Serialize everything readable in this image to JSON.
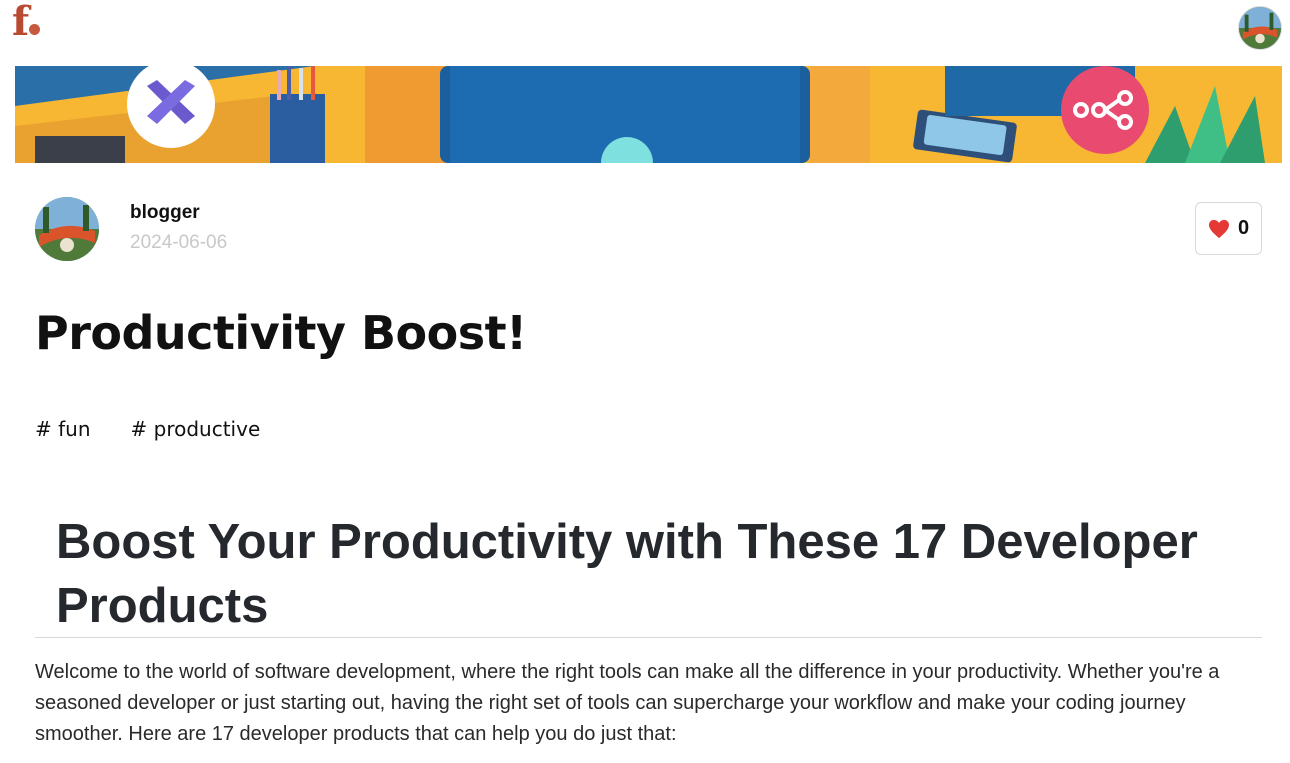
{
  "header": {
    "logo_text": "f",
    "logo_icon": "brand-logo-icon",
    "user_avatar_icon": "user-avatar"
  },
  "banner": {
    "image_icon": "desk-illustration-banner",
    "left_badge_icon": "tools-icon",
    "right_badge_icon": "workflow-nodes-icon"
  },
  "author": {
    "name": "blogger",
    "date": "2024-06-06",
    "avatar_icon": "author-avatar"
  },
  "like": {
    "icon": "heart-icon",
    "count": "0",
    "color": "#e53935"
  },
  "post": {
    "title": "Productivity Boost!",
    "tags": [
      "# fun",
      "# productive"
    ]
  },
  "article": {
    "heading": "Boost Your Productivity with These 17 Developer Products",
    "intro": "Welcome to the world of software development, where the right tools can make all the difference in your productivity. Whether you're a seasoned developer or just starting out, having the right set of tools can supercharge your workflow and make your coding journey smoother. Here are 17 developer products that can help you do just that:"
  },
  "colors": {
    "brand": "#b94a32",
    "muted_text": "#c8c8c8",
    "heading_text": "#25282c"
  }
}
